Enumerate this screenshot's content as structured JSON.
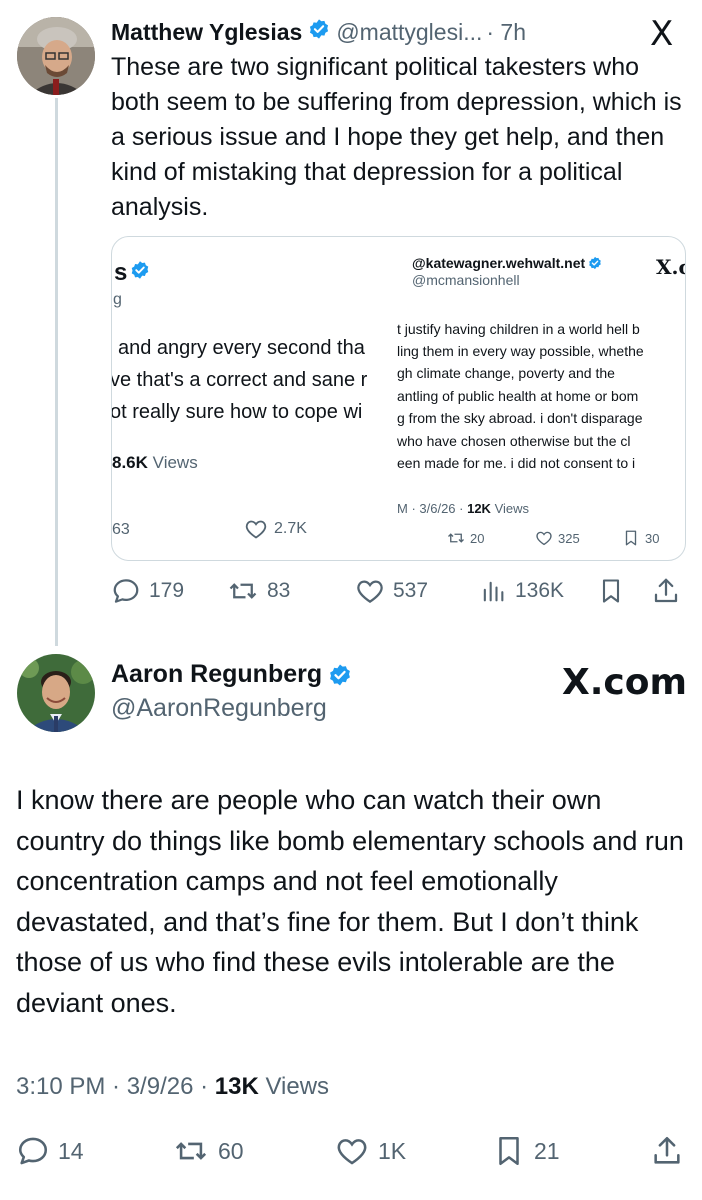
{
  "tweet1": {
    "name": "Matthew Yglesias",
    "handle": "@mattyglesi...",
    "time": "· 7h",
    "text": "These are two significant political takesters who both seem to be suffering from depression, which is a serious issue and I hope they get help, and then kind of mistaking that depression for a political analysis.",
    "x_logo": "X",
    "actions": {
      "replies": "179",
      "reposts": "83",
      "likes": "537",
      "views": "136K"
    }
  },
  "embed_left": {
    "name_fragment": "s",
    "handle_fragment": "g",
    "lines": [
      "and angry every second tha",
      "ve that's a correct and sane r",
      "ot really sure how to cope wi"
    ],
    "views_count": "8.6K",
    "views_label": "Views",
    "replies": "63",
    "likes": "2.7K"
  },
  "embed_right": {
    "name": "@katewagner.wehwalt.net",
    "handle": "@mcmansionhell",
    "x_logo": "X.c",
    "lines": [
      "t justify having children in a world hell b",
      "ling them in every way possible, whethe",
      "gh climate change, poverty and the",
      "antling of public health at home or bom",
      "g from the sky abroad. i don't disparage",
      "who have chosen otherwise but the cl",
      "een made for me. i did not consent to i"
    ],
    "meta_prefix": "M · 3/6/26 ·",
    "views_count": "12K",
    "views_label": "Views",
    "reposts": "20",
    "likes": "325",
    "bookmarks": "30"
  },
  "tweet2": {
    "name": "Aaron Regunberg",
    "handle": "@AaronRegunberg",
    "brand": "X.com",
    "text": "I know there are people who can watch their own country do things like bomb elementary schools and run concentration camps and not feel emotionally devastated, and that’s fine for them. But I don’t think those of us who find these evils intolerable are the deviant ones.",
    "meta_prefix": "3:10 PM · 3/9/26 ·",
    "views_count": "13K",
    "views_label": "Views",
    "actions": {
      "replies": "14",
      "reposts": "60",
      "likes": "1K",
      "bookmarks": "21"
    }
  },
  "colors": {
    "verified": "#1d9bf0",
    "muted": "#536471",
    "text": "#0f1419",
    "border": "#cfd9de"
  }
}
